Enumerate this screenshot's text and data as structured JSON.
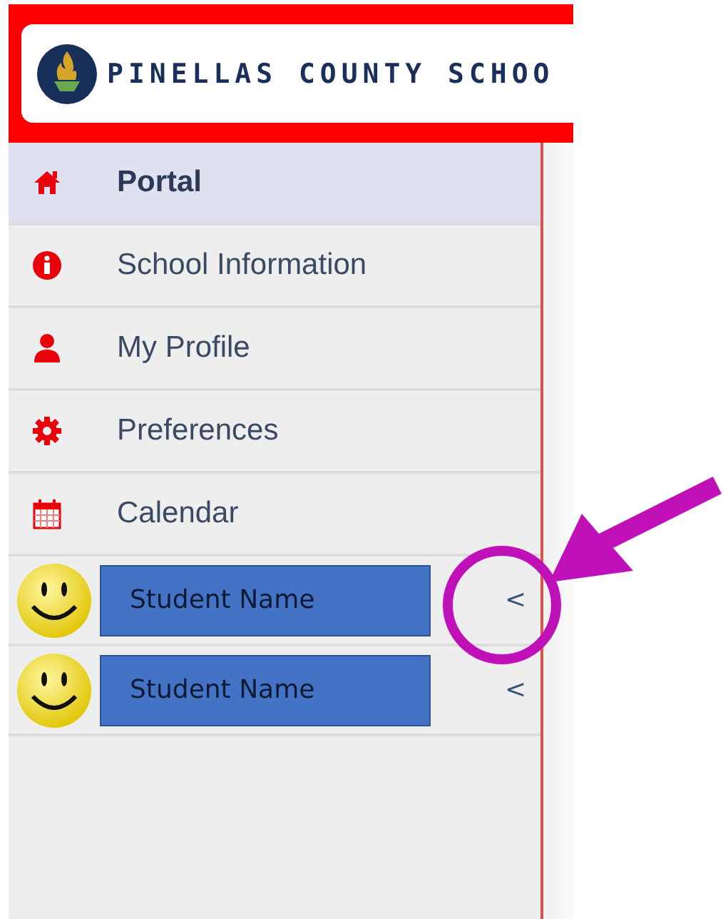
{
  "header": {
    "logo_text": "PINELLAS COUNTY SCHOO"
  },
  "menu": [
    {
      "label": "Portal",
      "selected": true
    },
    {
      "label": "School Information",
      "selected": false
    },
    {
      "label": "My Profile",
      "selected": false
    },
    {
      "label": "Preferences",
      "selected": false
    },
    {
      "label": "Calendar",
      "selected": false
    }
  ],
  "students": [
    {
      "name": "Student Name",
      "chevron": "<"
    },
    {
      "name": "Student Name",
      "chevron": "<"
    }
  ]
}
